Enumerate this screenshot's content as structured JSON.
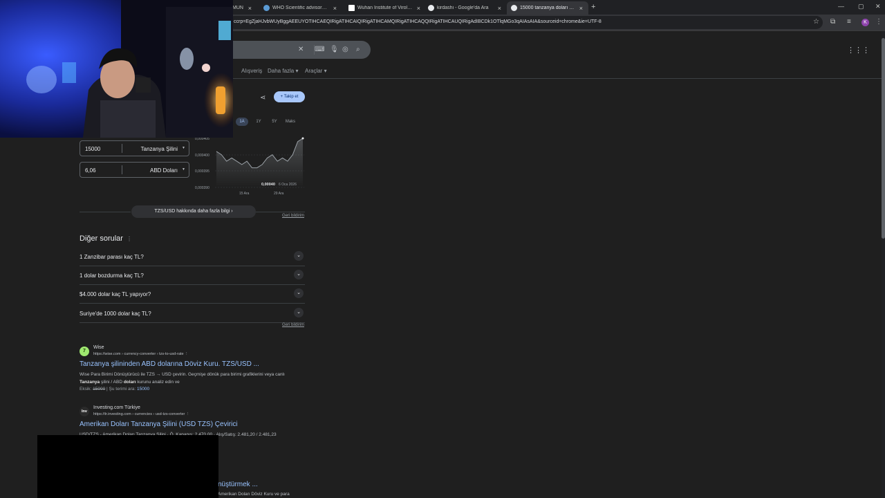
{
  "browser": {
    "tabs": [
      {
        "label": "MUN",
        "favicon_color": "#8ab4f8"
      },
      {
        "label": "WHO Scientific advisory group",
        "favicon_color": "#5b9bd5"
      },
      {
        "label": "Wuhan Institute of Virology - W",
        "favicon_color": "#ffffff"
      },
      {
        "label": "kirdashi - Google'da Ara",
        "favicon_color": "#e8eaed"
      },
      {
        "label": "15000 tanzanya doları - Google",
        "favicon_color": "#e8eaed"
      }
    ],
    "new_tab": "+",
    "url": "ccrp=EgZjaHJvbWUyBggAEEUYOTIHCAEQIRigATIHCAIQIRigATIHCAMQIRigATIHCAQQIRigATIHCAUQIRigAdIBCDk1OTlqMGo3qAIAsAIA&sourceid=chrome&ie=UTF-8",
    "profile_initial": "K"
  },
  "search": {
    "nav_tabs": [
      "Alışveriş",
      "Daha fazla",
      "Araçlar"
    ]
  },
  "finance": {
    "follow_label": "Takip et",
    "ranges": [
      "1A",
      "1Y",
      "5Y",
      "Maks"
    ],
    "selected_range": "1A",
    "from": {
      "amount": "15000",
      "currency": "Tanzanya Şilini"
    },
    "to": {
      "amount": "6,06",
      "currency": "ABD Doları"
    },
    "more_label": "TZS/USD hakkında daha fazla bilgi",
    "feedback": "Geri bildirim"
  },
  "chart_data": {
    "type": "line",
    "y_ticks": [
      "0,000400",
      "0,000395",
      "0,000390"
    ],
    "y_top_label": "0,000405",
    "x_ticks": [
      "15 Ara",
      "29 Ara"
    ],
    "ylim": [
      0.00039,
      0.000405
    ],
    "values": [
      0.000401,
      0.0004,
      0.000398,
      0.000399,
      0.000398,
      0.000397,
      0.000398,
      0.000396,
      0.000396,
      0.000397,
      0.000399,
      0.0004,
      0.000398,
      0.000399,
      0.000398,
      0.0004,
      0.000404,
      0.000405
    ],
    "current_value": "0,00040",
    "current_date": "6 Oca 2026",
    "line_color": "#9aa0a6"
  },
  "questions": {
    "title": "Diğer sorular",
    "items": [
      "1 Zanzibar parası kaç TL?",
      "1 dolar bozdurma kaç TL?",
      "$4.000 dolar kaç TL yapıyor?",
      "Suriye'de 1000 dolar kaç TL?"
    ],
    "feedback": "Geri bildirim"
  },
  "results": [
    {
      "site": "Wise",
      "url": "https://wise.com › currency-converter › tzs-to-usd-rate",
      "title": "Tanzanya şilininden ABD dolarına Döviz Kuru. TZS/USD ...",
      "snippet_line1": "Wise Para Birimi Dönüştürücü ile TZS → USD çevirin. Geçmişe dönük para birimi grafiklerini veya canlı",
      "snippet_line2_bold1": "Tanzanya",
      "snippet_line2_mid": " şilini / ABD ",
      "snippet_line2_bold2": "doları",
      "snippet_line2_end": " kurunu analiz edin ve",
      "missing_label": "Eksik:",
      "missing_term": "15000",
      "search_with": "| Şu terimi ara:",
      "search_term": "15000",
      "favicon_text": "7",
      "favicon_bg": "#9fe870",
      "favicon_color": "#163300"
    },
    {
      "site": "Investing.com Türkiye",
      "url": "https://tr.investing.com › currencies › usd-tzs-converter",
      "title": "Amerikan Doları Tanzanya Şilini (USD TZS) Çevirici",
      "snippet": "USD/TZS - Amerikan Doları Tanzanya Şilini · Ö. Kapanış: 2.470,00 · Alış/Satış: 2.481,20 / 2.481,23",
      "favicon_text": "Inv",
      "favicon_bg": "#2b2b2b",
      "favicon_color": "#ffffff"
    },
    {
      "title_fragment": "nüştürmek ...",
      "snippet_fragment": "Amerikan Doları Döviz Kuru ve para"
    }
  ]
}
